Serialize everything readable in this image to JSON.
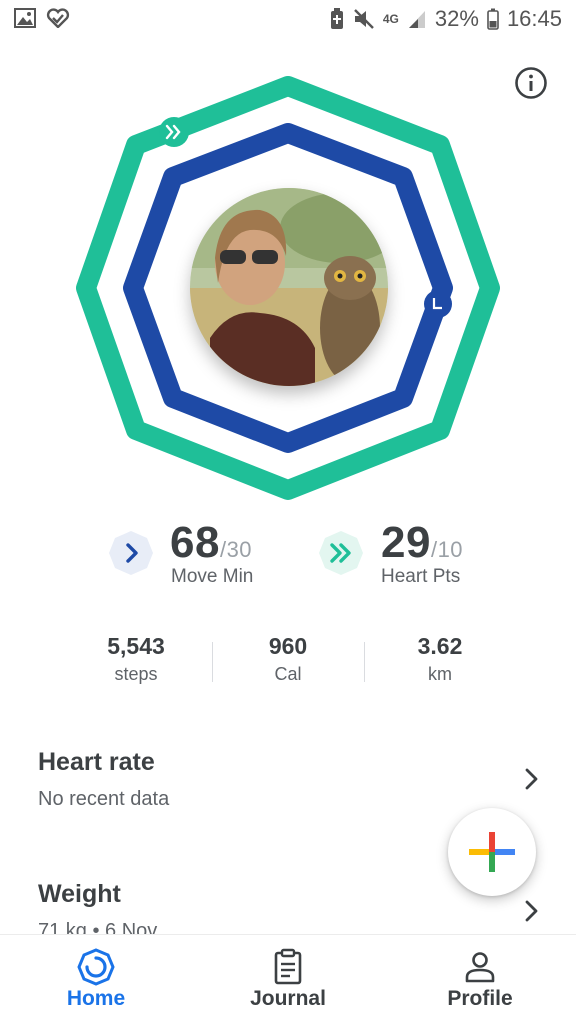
{
  "status_bar": {
    "left_icons": [
      "image-icon",
      "heart-check-icon"
    ],
    "right_icons": [
      "battery-saver-icon",
      "mute-icon",
      "network-4g-icon",
      "signal-icon",
      "battery-icon"
    ],
    "network_label": "4G",
    "battery": "32%",
    "time": "16:45"
  },
  "rings": {
    "move_min_color": "#1e4aa6",
    "heart_pts_color": "#1fbf98"
  },
  "goals": {
    "move": {
      "value": "68",
      "target": "/30",
      "label": "Move Min"
    },
    "heart": {
      "value": "29",
      "target": "/10",
      "label": "Heart Pts"
    }
  },
  "stats": [
    {
      "value": "5,543",
      "unit": "steps"
    },
    {
      "value": "960",
      "unit": "Cal"
    },
    {
      "value": "3.62",
      "unit": "km"
    }
  ],
  "cards": [
    {
      "title": "Heart rate",
      "subtitle": "No recent data"
    },
    {
      "title": "Weight",
      "subtitle": "71 kg • 6 Nov"
    }
  ],
  "nav": [
    {
      "label": "Home",
      "icon": "home-ring-icon",
      "active": true
    },
    {
      "label": "Journal",
      "icon": "journal-icon",
      "active": false
    },
    {
      "label": "Profile",
      "icon": "profile-icon",
      "active": false
    }
  ],
  "colors": {
    "accent": "#1a73e8",
    "move": "#1e4aa6",
    "heart": "#1fbf98"
  }
}
